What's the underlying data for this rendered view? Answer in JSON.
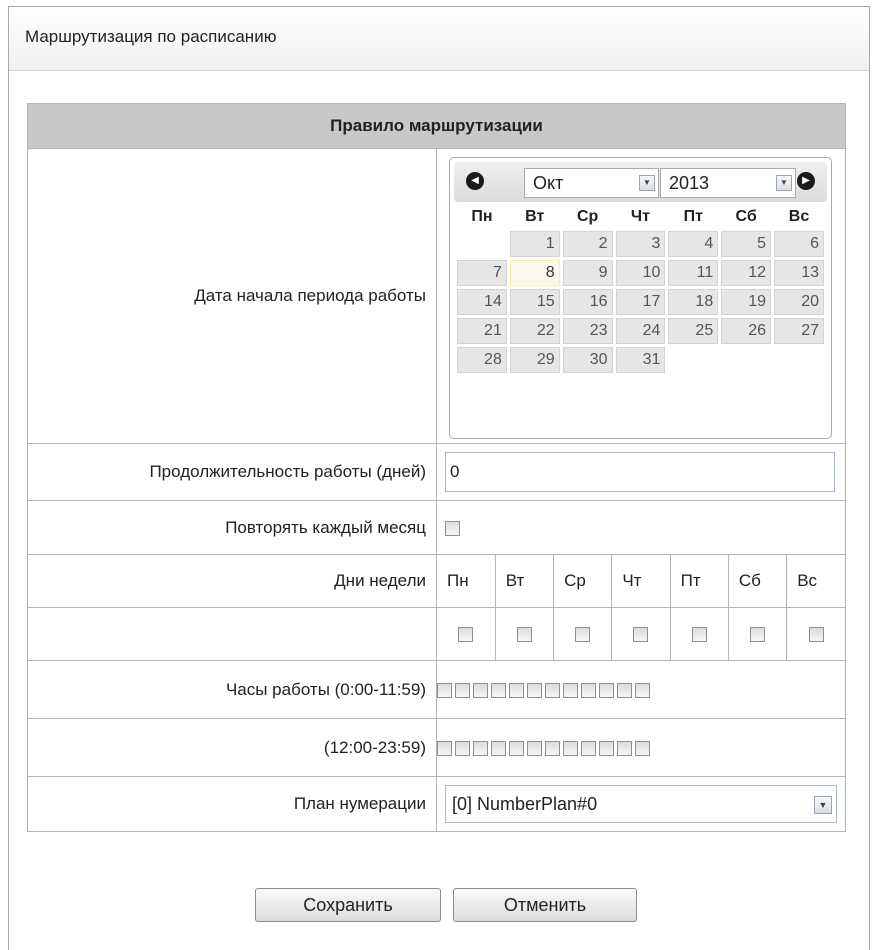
{
  "panel": {
    "title": "Маршрутизация по расписанию"
  },
  "rule": {
    "header": "Правило маршрутизации",
    "start_date": {
      "label": "Дата начала периода работы",
      "calendar": {
        "month": "Окт",
        "year": "2013",
        "weekdays": [
          "Пн",
          "Вт",
          "Ср",
          "Чт",
          "Пт",
          "Сб",
          "Вс"
        ],
        "weeks": [
          [
            "",
            "1",
            "2",
            "3",
            "4",
            "5",
            "6"
          ],
          [
            "7",
            "8",
            "9",
            "10",
            "11",
            "12",
            "13"
          ],
          [
            "14",
            "15",
            "16",
            "17",
            "18",
            "19",
            "20"
          ],
          [
            "21",
            "22",
            "23",
            "24",
            "25",
            "26",
            "27"
          ],
          [
            "28",
            "29",
            "30",
            "31",
            "",
            "",
            ""
          ]
        ],
        "highlighted_day": "8"
      }
    },
    "duration": {
      "label": "Продолжительность работы (дней)",
      "value": "0"
    },
    "repeat_monthly": {
      "label": "Повторять каждый месяц",
      "checked": false
    },
    "weekdays": {
      "label": "Дни недели",
      "days": [
        "Пн",
        "Вт",
        "Ср",
        "Чт",
        "Пт",
        "Сб",
        "Вс"
      ]
    },
    "hours_am": {
      "label": "Часы работы (0:00-11:59)",
      "count": 12
    },
    "hours_pm": {
      "label": "(12:00-23:59)",
      "count": 12
    },
    "numbering_plan": {
      "label": "План нумерации",
      "value": "[0] NumberPlan#0"
    }
  },
  "buttons": {
    "save": "Сохранить",
    "cancel": "Отменить"
  }
}
